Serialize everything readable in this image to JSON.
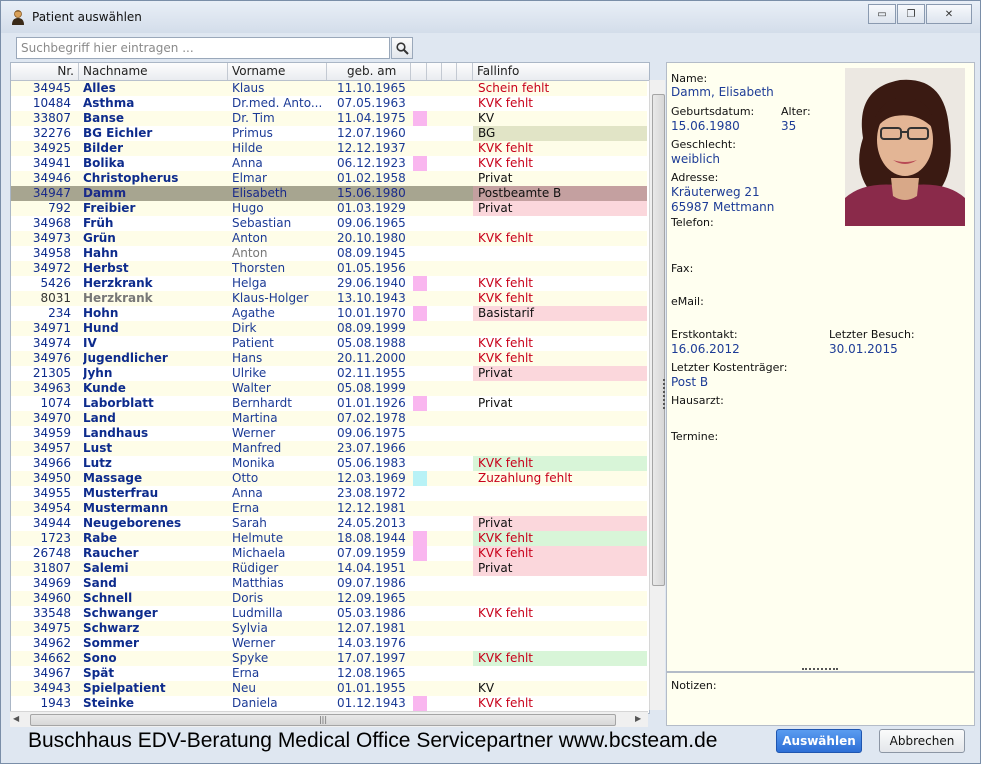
{
  "window": {
    "title": "Patient auswählen"
  },
  "search": {
    "placeholder": "Suchbegriff hier eintragen ..."
  },
  "columns": {
    "nr": "Nr.",
    "nachname": "Nachname",
    "vorname": "Vorname",
    "geb": "geb. am",
    "fallinfo": "Fallinfo"
  },
  "patients": [
    {
      "nr": "34945",
      "nachname": "Alles",
      "vorname": "Klaus",
      "geb": "11.10.1965",
      "mark": "",
      "fallinfo": "Schein fehlt",
      "fi_color": "red",
      "fi_bg": ""
    },
    {
      "nr": "10484",
      "nachname": "Asthma",
      "vorname": "Dr.med. Anto...",
      "geb": "07.05.1963",
      "mark": "",
      "fallinfo": "KVK fehlt",
      "fi_color": "red",
      "fi_bg": ""
    },
    {
      "nr": "33807",
      "nachname": "Banse",
      "vorname": "Dr. Tim",
      "geb": "11.04.1975",
      "mark": "pink",
      "fallinfo": "KV",
      "fi_color": "black",
      "fi_bg": ""
    },
    {
      "nr": "32276",
      "nachname": "BG Eichler",
      "vorname": "Primus",
      "geb": "12.07.1960",
      "mark": "",
      "fallinfo": "BG",
      "fi_color": "black",
      "fi_bg": "#e1e4c6"
    },
    {
      "nr": "34925",
      "nachname": "Bilder",
      "vorname": "Hilde",
      "geb": "12.12.1937",
      "mark": "",
      "fallinfo": "KVK fehlt",
      "fi_color": "red",
      "fi_bg": ""
    },
    {
      "nr": "34941",
      "nachname": "Bolika",
      "vorname": "Anna",
      "geb": "06.12.1923",
      "mark": "pink",
      "fallinfo": "KVK fehlt",
      "fi_color": "red",
      "fi_bg": ""
    },
    {
      "nr": "34946",
      "nachname": "Christopherus",
      "vorname": "Elmar",
      "geb": "01.02.1958",
      "mark": "",
      "fallinfo": "Privat",
      "fi_color": "black",
      "fi_bg": ""
    },
    {
      "nr": "34947",
      "nachname": "Damm",
      "vorname": "Elisabeth",
      "geb": "15.06.1980",
      "mark": "",
      "fallinfo": "Postbeamte B",
      "fi_color": "black",
      "fi_bg": "#c4a0a0",
      "selected": true
    },
    {
      "nr": "792",
      "nachname": "Freibier",
      "vorname": "Hugo",
      "geb": "01.03.1929",
      "mark": "",
      "fallinfo": "Privat",
      "fi_color": "black",
      "fi_bg": "#fbd7dc"
    },
    {
      "nr": "34968",
      "nachname": "Früh",
      "vorname": "Sebastian",
      "geb": "09.06.1965",
      "mark": "",
      "fallinfo": "",
      "fi_color": "black",
      "fi_bg": ""
    },
    {
      "nr": "34973",
      "nachname": "Grün",
      "vorname": "Anton",
      "geb": "20.10.1980",
      "mark": "",
      "fallinfo": "KVK fehlt",
      "fi_color": "red",
      "fi_bg": ""
    },
    {
      "nr": "34958",
      "nachname": "Hahn",
      "vorname": "Anton",
      "geb": "08.09.1945",
      "mark": "",
      "fallinfo": "",
      "fi_color": "black",
      "fi_bg": "",
      "vn_gray": true
    },
    {
      "nr": "34972",
      "nachname": "Herbst",
      "vorname": "Thorsten",
      "geb": "01.05.1956",
      "mark": "",
      "fallinfo": "",
      "fi_color": "black",
      "fi_bg": ""
    },
    {
      "nr": "5426",
      "nachname": "Herzkrank",
      "vorname": "Helga",
      "geb": "29.06.1940",
      "mark": "pink",
      "fallinfo": "KVK fehlt",
      "fi_color": "red",
      "fi_bg": ""
    },
    {
      "nr": "8031",
      "nachname": "Herzkrank",
      "vorname": "Klaus-Holger",
      "geb": "13.10.1943",
      "mark": "",
      "fallinfo": "KVK fehlt",
      "fi_color": "red",
      "fi_bg": "",
      "nn_gray": true
    },
    {
      "nr": "234",
      "nachname": "Hohn",
      "vorname": "Agathe",
      "geb": "10.01.1970",
      "mark": "pink",
      "fallinfo": "Basistarif",
      "fi_color": "black",
      "fi_bg": "#fbd7dc"
    },
    {
      "nr": "34971",
      "nachname": "Hund",
      "vorname": "Dirk",
      "geb": "08.09.1999",
      "mark": "",
      "fallinfo": "",
      "fi_color": "black",
      "fi_bg": ""
    },
    {
      "nr": "34974",
      "nachname": "IV",
      "vorname": "Patient",
      "geb": "05.08.1988",
      "mark": "",
      "fallinfo": "KVK fehlt",
      "fi_color": "red",
      "fi_bg": ""
    },
    {
      "nr": "34976",
      "nachname": "Jugendlicher",
      "vorname": "Hans",
      "geb": "20.11.2000",
      "mark": "",
      "fallinfo": "KVK fehlt",
      "fi_color": "red",
      "fi_bg": ""
    },
    {
      "nr": "21305",
      "nachname": "Jyhn",
      "vorname": "Ulrike",
      "geb": "02.11.1955",
      "mark": "",
      "fallinfo": "Privat",
      "fi_color": "black",
      "fi_bg": "#fbd7dc"
    },
    {
      "nr": "34963",
      "nachname": "Kunde",
      "vorname": "Walter",
      "geb": "05.08.1999",
      "mark": "",
      "fallinfo": "",
      "fi_color": "black",
      "fi_bg": ""
    },
    {
      "nr": "1074",
      "nachname": "Laborblatt",
      "vorname": "Bernhardt",
      "geb": "01.01.1926",
      "mark": "pink",
      "fallinfo": "Privat",
      "fi_color": "black",
      "fi_bg": ""
    },
    {
      "nr": "34970",
      "nachname": "Land",
      "vorname": "Martina",
      "geb": "07.02.1978",
      "mark": "",
      "fallinfo": "",
      "fi_color": "black",
      "fi_bg": ""
    },
    {
      "nr": "34959",
      "nachname": "Landhaus",
      "vorname": "Werner",
      "geb": "09.06.1975",
      "mark": "",
      "fallinfo": "",
      "fi_color": "black",
      "fi_bg": ""
    },
    {
      "nr": "34957",
      "nachname": "Lust",
      "vorname": "Manfred",
      "geb": "23.07.1966",
      "mark": "",
      "fallinfo": "",
      "fi_color": "black",
      "fi_bg": ""
    },
    {
      "nr": "34966",
      "nachname": "Lutz",
      "vorname": "Monika",
      "geb": "05.06.1983",
      "mark": "",
      "fallinfo": "KVK fehlt",
      "fi_color": "red",
      "fi_bg": "#d8f5d8"
    },
    {
      "nr": "34950",
      "nachname": "Massage",
      "vorname": "Otto",
      "geb": "12.03.1969",
      "mark": "cyan",
      "fallinfo": "Zuzahlung fehlt",
      "fi_color": "red",
      "fi_bg": ""
    },
    {
      "nr": "34955",
      "nachname": "Musterfrau",
      "vorname": "Anna",
      "geb": "23.08.1972",
      "mark": "",
      "fallinfo": "",
      "fi_color": "black",
      "fi_bg": ""
    },
    {
      "nr": "34954",
      "nachname": "Mustermann",
      "vorname": "Erna",
      "geb": "12.12.1981",
      "mark": "",
      "fallinfo": "",
      "fi_color": "black",
      "fi_bg": ""
    },
    {
      "nr": "34944",
      "nachname": "Neugeborenes",
      "vorname": "Sarah",
      "geb": "24.05.2013",
      "mark": "",
      "fallinfo": "Privat",
      "fi_color": "black",
      "fi_bg": "#fbd7dc"
    },
    {
      "nr": "1723",
      "nachname": "Rabe",
      "vorname": "Helmute",
      "geb": "18.08.1944",
      "mark": "pink",
      "fallinfo": "KVK fehlt",
      "fi_color": "red",
      "fi_bg": "#d8f5d8"
    },
    {
      "nr": "26748",
      "nachname": "Raucher",
      "vorname": "Michaela",
      "geb": "07.09.1959",
      "mark": "pink",
      "fallinfo": "KVK fehlt",
      "fi_color": "red",
      "fi_bg": "#fbd7dc"
    },
    {
      "nr": "31807",
      "nachname": "Salemi",
      "vorname": "Rüdiger",
      "geb": "14.04.1951",
      "mark": "",
      "fallinfo": "Privat",
      "fi_color": "black",
      "fi_bg": "#fbd7dc"
    },
    {
      "nr": "34969",
      "nachname": "Sand",
      "vorname": "Matthias",
      "geb": "09.07.1986",
      "mark": "",
      "fallinfo": "",
      "fi_color": "black",
      "fi_bg": ""
    },
    {
      "nr": "34960",
      "nachname": "Schnell",
      "vorname": "Doris",
      "geb": "12.09.1965",
      "mark": "",
      "fallinfo": "",
      "fi_color": "black",
      "fi_bg": ""
    },
    {
      "nr": "33548",
      "nachname": "Schwanger",
      "vorname": "Ludmilla",
      "geb": "05.03.1986",
      "mark": "",
      "fallinfo": "KVK fehlt",
      "fi_color": "red",
      "fi_bg": ""
    },
    {
      "nr": "34975",
      "nachname": "Schwarz",
      "vorname": "Sylvia",
      "geb": "12.07.1981",
      "mark": "",
      "fallinfo": "",
      "fi_color": "black",
      "fi_bg": ""
    },
    {
      "nr": "34962",
      "nachname": "Sommer",
      "vorname": "Werner",
      "geb": "14.03.1976",
      "mark": "",
      "fallinfo": "",
      "fi_color": "black",
      "fi_bg": ""
    },
    {
      "nr": "34662",
      "nachname": "Sono",
      "vorname": "Spyke",
      "geb": "17.07.1997",
      "mark": "",
      "fallinfo": "KVK fehlt",
      "fi_color": "red",
      "fi_bg": "#d8f5d8"
    },
    {
      "nr": "34967",
      "nachname": "Spät",
      "vorname": "Erna",
      "geb": "12.08.1965",
      "mark": "",
      "fallinfo": "",
      "fi_color": "black",
      "fi_bg": ""
    },
    {
      "nr": "34943",
      "nachname": "Spielpatient",
      "vorname": "Neu",
      "geb": "01.01.1955",
      "mark": "",
      "fallinfo": "KV",
      "fi_color": "black",
      "fi_bg": ""
    },
    {
      "nr": "1943",
      "nachname": "Steinke",
      "vorname": "Daniela",
      "geb": "01.12.1943",
      "mark": "pink",
      "fallinfo": "KVK fehlt",
      "fi_color": "red",
      "fi_bg": ""
    }
  ],
  "detail": {
    "name_label": "Name:",
    "name": "Damm, Elisabeth",
    "dob_label": "Geburtsdatum:",
    "dob": "15.06.1980",
    "age_label": "Alter:",
    "age": "35",
    "gender_label": "Geschlecht:",
    "gender": "weiblich",
    "address_label": "Adresse:",
    "street": "Kräuterweg 21",
    "city": "65987 Mettmann",
    "phone_label": "Telefon:",
    "fax_label": "Fax:",
    "email_label": "eMail:",
    "first_contact_label": "Erstkontakt:",
    "first_contact": "16.06.2012",
    "last_visit_label": "Letzter Besuch:",
    "last_visit": "30.01.2015",
    "payer_label": "Letzter Kostenträger:",
    "payer": "Post B",
    "gp_label": "Hausarzt:",
    "appointments_label": "Termine:"
  },
  "notes": {
    "label": "Notizen:"
  },
  "footer": {
    "text": "Buschhaus EDV-Beratung Medical Office Servicepartner www.bcsteam.de"
  },
  "buttons": {
    "select": "Auswählen",
    "cancel": "Abbrechen"
  },
  "colors": {
    "mark_pink": "#f9b6ef",
    "mark_cyan": "#b8f2f6",
    "fallinfo_red": "#c8001a",
    "name_blue": "#0d2b8c",
    "select_button": "#2d6fd6"
  },
  "icons": {
    "window": "patient-icon",
    "search": "search-icon",
    "minimize": "minimize-icon",
    "maximize": "maximize-icon",
    "close": "close-icon",
    "photo": "patient-photo"
  }
}
